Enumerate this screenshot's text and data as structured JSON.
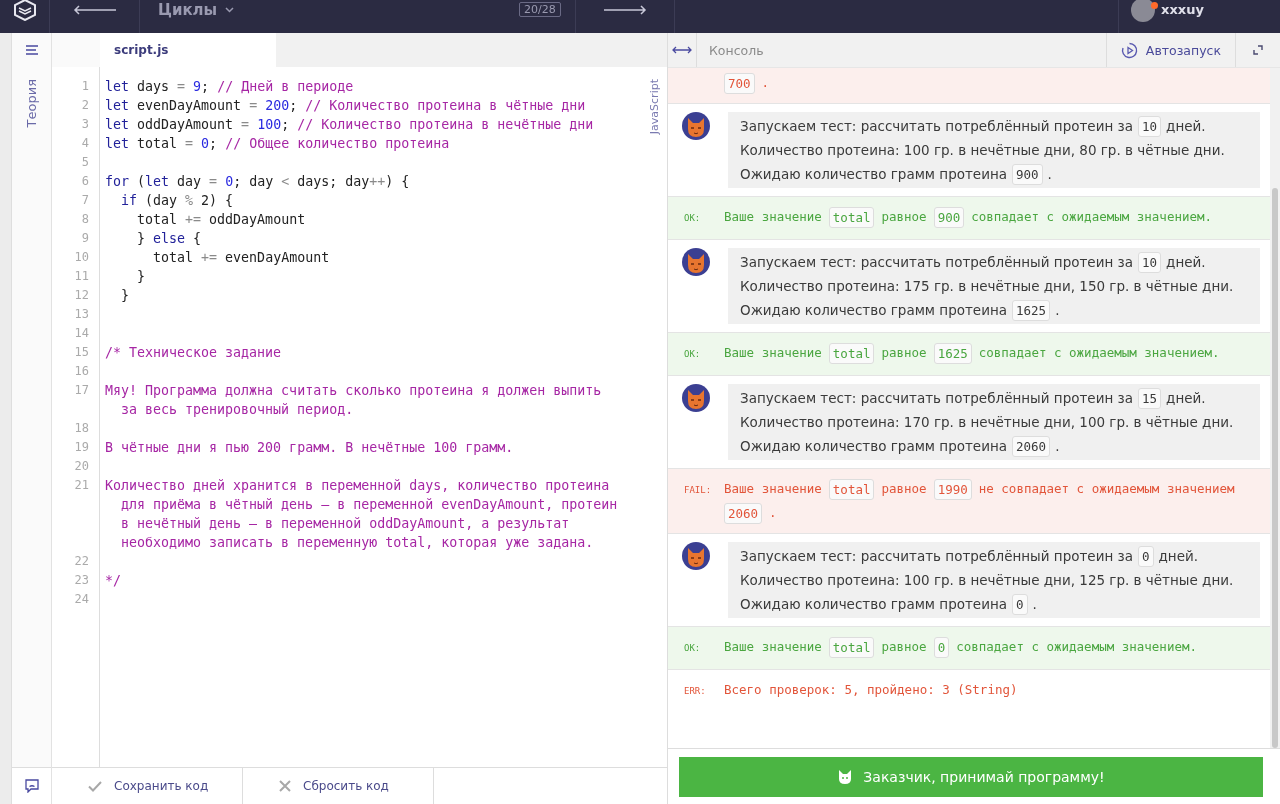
{
  "topbar": {
    "title": "Циклы",
    "counter": "20/28",
    "user": "xxxuy"
  },
  "sidebar": {
    "label": "Теория"
  },
  "editor": {
    "tabs": [
      {
        "label": "script.js",
        "selected": true
      }
    ],
    "language": "JavaScript",
    "lines": [
      {
        "n": "1",
        "tokens": [
          {
            "kind": "kw",
            "t": "let"
          },
          {
            "kind": "var",
            "t": " days "
          },
          {
            "kind": "op",
            "t": "= "
          },
          {
            "kind": "num",
            "t": "9"
          },
          {
            "kind": "var",
            "t": "; "
          },
          {
            "kind": "com",
            "t": "// Дней в периоде"
          }
        ]
      },
      {
        "n": "2",
        "tokens": [
          {
            "kind": "kw",
            "t": "let"
          },
          {
            "kind": "var",
            "t": " evenDayAmount "
          },
          {
            "kind": "op",
            "t": "= "
          },
          {
            "kind": "num",
            "t": "200"
          },
          {
            "kind": "var",
            "t": "; "
          },
          {
            "kind": "com",
            "t": "// Количество протеина в чётные дни"
          }
        ]
      },
      {
        "n": "3",
        "tokens": [
          {
            "kind": "kw",
            "t": "let"
          },
          {
            "kind": "var",
            "t": " oddDayAmount "
          },
          {
            "kind": "op",
            "t": "= "
          },
          {
            "kind": "num",
            "t": "100"
          },
          {
            "kind": "var",
            "t": "; "
          },
          {
            "kind": "com",
            "t": "// Количество протеина в нечётные дни"
          }
        ]
      },
      {
        "n": "4",
        "tokens": [
          {
            "kind": "kw",
            "t": "let"
          },
          {
            "kind": "var",
            "t": " total "
          },
          {
            "kind": "op",
            "t": "= "
          },
          {
            "kind": "num",
            "t": "0"
          },
          {
            "kind": "var",
            "t": "; "
          },
          {
            "kind": "com",
            "t": "// Общее количество протеина"
          }
        ]
      },
      {
        "n": "5"
      },
      {
        "n": "6",
        "tokens": [
          {
            "kind": "kw",
            "t": "for"
          },
          {
            "kind": "var",
            "t": " ("
          },
          {
            "kind": "kw",
            "t": "let"
          },
          {
            "kind": "var",
            "t": " day "
          },
          {
            "kind": "op",
            "t": "= "
          },
          {
            "kind": "num",
            "t": "0"
          },
          {
            "kind": "var",
            "t": "; day "
          },
          {
            "kind": "op",
            "t": "<"
          },
          {
            "kind": "var",
            "t": " days; day"
          },
          {
            "kind": "op",
            "t": "++"
          },
          {
            "kind": "var",
            "t": ") {"
          }
        ]
      },
      {
        "n": "7",
        "tokens": [
          {
            "kind": "kw",
            "t": "  if"
          },
          {
            "kind": "var",
            "t": " (day "
          },
          {
            "kind": "op",
            "t": "%"
          },
          {
            "kind": "var",
            "t": " 2) {"
          }
        ]
      },
      {
        "n": "8",
        "tokens": [
          {
            "kind": "var",
            "t": "    total "
          },
          {
            "kind": "op",
            "t": "+="
          },
          {
            "kind": "var",
            "t": " oddDayAmount"
          }
        ]
      },
      {
        "n": "9",
        "tokens": [
          {
            "kind": "var",
            "t": "    } "
          },
          {
            "kind": "kw",
            "t": "else"
          },
          {
            "kind": "var",
            "t": " {"
          }
        ]
      },
      {
        "n": "10",
        "tokens": [
          {
            "kind": "var",
            "t": "      total "
          },
          {
            "kind": "op",
            "t": "+="
          },
          {
            "kind": "var",
            "t": " evenDayAmount"
          }
        ]
      },
      {
        "n": "11",
        "tokens": [
          {
            "kind": "var",
            "t": "    }"
          }
        ]
      },
      {
        "n": "12",
        "tokens": [
          {
            "kind": "var",
            "t": "  }"
          }
        ]
      },
      {
        "n": "13"
      },
      {
        "n": "14"
      },
      {
        "n": "15",
        "tokens": [
          {
            "kind": "com",
            "t": "/* Техническое задание"
          }
        ]
      },
      {
        "n": "16"
      },
      {
        "n": "17",
        "tokens": [
          {
            "kind": "com",
            "t": "Мяу! Программа должна считать сколько протеина я должен выпить"
          }
        ],
        "wrap": [
          "за весь тренировочный период."
        ]
      },
      {
        "n": "18"
      },
      {
        "n": "19",
        "tokens": [
          {
            "kind": "com",
            "t": "В чётные дни я пью 200 грамм. В нечётные 100 грамм."
          }
        ]
      },
      {
        "n": "20"
      },
      {
        "n": "21",
        "tokens": [
          {
            "kind": "com",
            "t": "Количество дней хранится в переменной days, количество протеина"
          }
        ],
        "wrap": [
          "для приёма в чётный день — в переменной evenDayAmount, протеин",
          "в нечётный день — в переменной oddDayAmount, а результат",
          "необходимо записать в переменную total, которая уже задана."
        ]
      },
      {
        "n": "22"
      },
      {
        "n": "23",
        "tokens": [
          {
            "kind": "com",
            "t": "*/"
          }
        ]
      },
      {
        "n": "24"
      }
    ]
  },
  "footer": {
    "buttons": [
      {
        "label": "Сохранить код",
        "kind": "save"
      },
      {
        "label": "Сбросить код",
        "kind": "reset"
      }
    ]
  },
  "console": {
    "title": "Консоль",
    "autorun": "Автозапуск",
    "submit": "Заказчик, принимай программу!",
    "log": [
      {
        "kind": "fail",
        "lines": [
          [
            {
              "t": "700",
              "code": true
            },
            {
              "t": "."
            }
          ]
        ]
      },
      {
        "kind": "message",
        "lines": [
          [
            {
              "t": "Запускаем тест: рассчитать потреблённый протеин за"
            },
            {
              "t": "10",
              "code": true
            },
            {
              "t": "дней."
            }
          ],
          [
            {
              "t": "Количество протеина: 100 гр. в нечётные дни, 80 гр. в чётные дни."
            }
          ],
          [
            {
              "t": "Ожидаю количество грамм протеина"
            },
            {
              "t": "900",
              "code": true
            },
            {
              "t": "."
            }
          ]
        ]
      },
      {
        "kind": "ok",
        "label": "OK:",
        "lines": [
          [
            {
              "t": "Ваше значение"
            },
            {
              "t": "total",
              "code": true
            },
            {
              "t": "равное"
            },
            {
              "t": "900",
              "code": true
            },
            {
              "t": "совпадает с ожидаемым значением."
            }
          ]
        ]
      },
      {
        "kind": "message",
        "lines": [
          [
            {
              "t": "Запускаем тест: рассчитать потреблённый протеин за"
            },
            {
              "t": "10",
              "code": true
            },
            {
              "t": "дней."
            }
          ],
          [
            {
              "t": "Количество протеина: 175 гр. в нечётные дни, 150 гр. в чётные дни."
            }
          ],
          [
            {
              "t": "Ожидаю количество грамм протеина"
            },
            {
              "t": "1625",
              "code": true
            },
            {
              "t": "."
            }
          ]
        ]
      },
      {
        "kind": "ok",
        "label": "OK:",
        "lines": [
          [
            {
              "t": "Ваше значение"
            },
            {
              "t": "total",
              "code": true
            },
            {
              "t": "равное"
            },
            {
              "t": "1625",
              "code": true
            },
            {
              "t": "совпадает с ожидаемым значением."
            }
          ]
        ]
      },
      {
        "kind": "message",
        "lines": [
          [
            {
              "t": "Запускаем тест: рассчитать потреблённый протеин за"
            },
            {
              "t": "15",
              "code": true
            },
            {
              "t": "дней."
            }
          ],
          [
            {
              "t": "Количество протеина: 170 гр. в нечётные дни, 100 гр. в чётные дни."
            }
          ],
          [
            {
              "t": "Ожидаю количество грамм протеина"
            },
            {
              "t": "2060",
              "code": true
            },
            {
              "t": "."
            }
          ]
        ]
      },
      {
        "kind": "fail",
        "label": "FAIL:",
        "lines": [
          [
            {
              "t": "Ваше значение"
            },
            {
              "t": "total",
              "code": true
            },
            {
              "t": "равное"
            },
            {
              "t": "1990",
              "code": true
            },
            {
              "t": "не совпадает с ожидаемым значением"
            }
          ],
          [
            {
              "t": "2060",
              "code": true
            },
            {
              "t": "."
            }
          ]
        ]
      },
      {
        "kind": "message",
        "lines": [
          [
            {
              "t": "Запускаем тест: рассчитать потреблённый протеин за"
            },
            {
              "t": "0",
              "code": true
            },
            {
              "t": "дней."
            }
          ],
          [
            {
              "t": "Количество протеина: 100 гр. в нечётные дни, 125 гр. в чётные дни."
            }
          ],
          [
            {
              "t": "Ожидаю количество грамм протеина"
            },
            {
              "t": "0",
              "code": true
            },
            {
              "t": "."
            }
          ]
        ]
      },
      {
        "kind": "ok",
        "label": "OK:",
        "lines": [
          [
            {
              "t": "Ваше значение"
            },
            {
              "t": "total",
              "code": true
            },
            {
              "t": "равное"
            },
            {
              "t": "0",
              "code": true
            },
            {
              "t": "совпадает с ожидаемым значением."
            }
          ]
        ]
      },
      {
        "kind": "err",
        "label": "ERR:",
        "lines": [
          [
            {
              "t": "Всего проверок: 5, пройдено: 3 (String)"
            }
          ]
        ]
      }
    ]
  }
}
